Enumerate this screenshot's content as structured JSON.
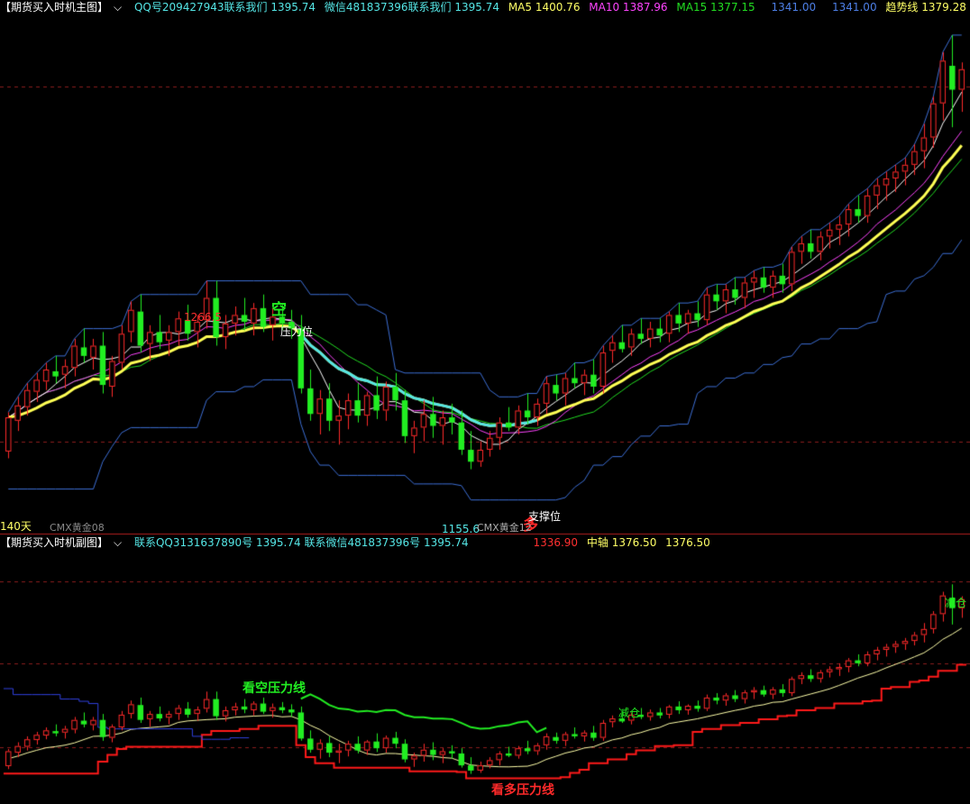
{
  "main_header": {
    "title": "【期货买入时机主图】",
    "qq": "QQ号209427943联系我们 1395.74",
    "wechat": "微信481837396联系我们 1395.74",
    "ma5": "MA5 1400.76",
    "ma10": "MA10 1387.96",
    "ma15": "MA15 1377.15",
    "band1": "1341.00",
    "band2": "1341.00",
    "trend": "趋势线 1379.28"
  },
  "sub_header": {
    "title": "【期货买入时机副图】",
    "contact": "联系QQ3131637890号 1395.74  联系微信481837396号 1395.74",
    "low_band": "1336.90",
    "mid_axis": "中轴 1376.50",
    "mid_axis_value": "1376.50"
  },
  "annotations": {
    "high_label": "1266.5",
    "low_label": "1155.6",
    "short_signal": "空",
    "long_signal": "多",
    "resistance": "压力位",
    "support": "支撑位",
    "days": "140天",
    "contract_left": "CMX黄金08",
    "contract_right": "CMX黄金12",
    "reduce1": "减仓",
    "reduce2": "减仓",
    "bear_line": "看空压力线",
    "bull_line": "看多压力线"
  },
  "colors": {
    "up": "#ff2a2a",
    "down": "#22ee22",
    "ma5": "#ffffff",
    "ma10": "#ff44ff",
    "ma15": "#22dd22",
    "trend": "#ffff55",
    "band": "#3d6fd6",
    "cyan": "#55e6e6",
    "grid": "#8a1d1d"
  },
  "chart_data": {
    "type": "candlestick",
    "candles": [
      [
        1166,
        1189,
        1162,
        1186
      ],
      [
        1184,
        1198,
        1178,
        1193
      ],
      [
        1192,
        1206,
        1187,
        1202
      ],
      [
        1201,
        1212,
        1195,
        1208
      ],
      [
        1207,
        1218,
        1202,
        1214
      ],
      [
        1213,
        1222,
        1206,
        1210
      ],
      [
        1211,
        1220,
        1203,
        1216
      ],
      [
        1215,
        1232,
        1210,
        1228
      ],
      [
        1227,
        1238,
        1218,
        1222
      ],
      [
        1221,
        1232,
        1214,
        1228
      ],
      [
        1228,
        1236,
        1200,
        1205
      ],
      [
        1204,
        1222,
        1198,
        1219
      ],
      [
        1218,
        1240,
        1214,
        1235
      ],
      [
        1236,
        1254,
        1230,
        1249
      ],
      [
        1248,
        1258,
        1224,
        1228
      ],
      [
        1229,
        1240,
        1219,
        1236
      ],
      [
        1236,
        1246,
        1226,
        1230
      ],
      [
        1231,
        1240,
        1222,
        1236
      ],
      [
        1236,
        1248,
        1228,
        1244
      ],
      [
        1243,
        1252,
        1231,
        1235
      ],
      [
        1236,
        1246,
        1227,
        1242
      ],
      [
        1243,
        1266,
        1238,
        1256
      ],
      [
        1256,
        1266,
        1228,
        1233
      ],
      [
        1233,
        1246,
        1226,
        1241
      ],
      [
        1241,
        1251,
        1234,
        1246
      ],
      [
        1246,
        1256,
        1237,
        1242
      ],
      [
        1241,
        1253,
        1234,
        1250
      ],
      [
        1250,
        1258,
        1236,
        1239
      ],
      [
        1240,
        1250,
        1231,
        1245
      ],
      [
        1245,
        1252,
        1237,
        1241
      ],
      [
        1242,
        1249,
        1232,
        1238
      ],
      [
        1238,
        1246,
        1200,
        1203
      ],
      [
        1203,
        1214,
        1184,
        1188
      ],
      [
        1188,
        1202,
        1176,
        1197
      ],
      [
        1197,
        1206,
        1178,
        1184
      ],
      [
        1184,
        1196,
        1170,
        1187
      ],
      [
        1187,
        1200,
        1179,
        1196
      ],
      [
        1196,
        1206,
        1183,
        1187
      ],
      [
        1187,
        1201,
        1181,
        1199
      ],
      [
        1199,
        1210,
        1185,
        1190
      ],
      [
        1190,
        1207,
        1184,
        1204
      ],
      [
        1204,
        1212,
        1190,
        1196
      ],
      [
        1196,
        1202,
        1171,
        1175
      ],
      [
        1175,
        1184,
        1165,
        1180
      ],
      [
        1180,
        1196,
        1172,
        1188
      ],
      [
        1188,
        1198,
        1174,
        1181
      ],
      [
        1181,
        1190,
        1170,
        1186
      ],
      [
        1186,
        1194,
        1176,
        1183
      ],
      [
        1183,
        1190,
        1164,
        1167
      ],
      [
        1167,
        1178,
        1155.6,
        1160
      ],
      [
        1160,
        1172,
        1157,
        1167
      ],
      [
        1167,
        1178,
        1163,
        1174
      ],
      [
        1174,
        1186,
        1167,
        1183
      ],
      [
        1183,
        1192,
        1178,
        1180
      ],
      [
        1180,
        1193,
        1176,
        1190
      ],
      [
        1190,
        1200,
        1182,
        1186
      ],
      [
        1186,
        1197,
        1181,
        1194
      ],
      [
        1194,
        1210,
        1188,
        1206
      ],
      [
        1205,
        1211,
        1196,
        1200
      ],
      [
        1200,
        1212,
        1193,
        1209
      ],
      [
        1209,
        1218,
        1203,
        1206
      ],
      [
        1206,
        1214,
        1199,
        1211
      ],
      [
        1211,
        1220,
        1200,
        1204
      ],
      [
        1204,
        1228,
        1200,
        1224
      ],
      [
        1225,
        1234,
        1218,
        1230
      ],
      [
        1230,
        1240,
        1224,
        1226
      ],
      [
        1227,
        1238,
        1222,
        1235
      ],
      [
        1235,
        1244,
        1229,
        1232
      ],
      [
        1232,
        1242,
        1227,
        1238
      ],
      [
        1238,
        1244,
        1230,
        1234
      ],
      [
        1235,
        1248,
        1230,
        1246
      ],
      [
        1246,
        1253,
        1236,
        1241
      ],
      [
        1241,
        1249,
        1235,
        1247
      ],
      [
        1247,
        1254,
        1239,
        1243
      ],
      [
        1243,
        1262,
        1240,
        1258
      ],
      [
        1258,
        1264,
        1249,
        1254
      ],
      [
        1254,
        1264,
        1247,
        1261
      ],
      [
        1261,
        1268,
        1252,
        1256
      ],
      [
        1256,
        1268,
        1250,
        1265
      ],
      [
        1265,
        1272,
        1256,
        1268
      ],
      [
        1268,
        1274,
        1259,
        1262
      ],
      [
        1262,
        1272,
        1256,
        1269
      ],
      [
        1269,
        1276,
        1259,
        1264
      ],
      [
        1264,
        1286,
        1260,
        1283
      ],
      [
        1283,
        1292,
        1276,
        1288
      ],
      [
        1288,
        1296,
        1279,
        1283
      ],
      [
        1283,
        1295,
        1278,
        1292
      ],
      [
        1292,
        1300,
        1285,
        1296
      ],
      [
        1296,
        1304,
        1287,
        1299
      ],
      [
        1299,
        1311,
        1292,
        1308
      ],
      [
        1308,
        1316,
        1300,
        1304
      ],
      [
        1304,
        1320,
        1300,
        1316
      ],
      [
        1316,
        1326,
        1308,
        1322
      ],
      [
        1322,
        1330,
        1313,
        1326
      ],
      [
        1326,
        1334,
        1318,
        1330
      ],
      [
        1330,
        1338,
        1322,
        1334
      ],
      [
        1334,
        1346,
        1328,
        1342
      ],
      [
        1342,
        1358,
        1332,
        1350
      ],
      [
        1350,
        1374,
        1344,
        1370
      ],
      [
        1370,
        1400,
        1360,
        1395
      ],
      [
        1392,
        1410,
        1356,
        1378
      ],
      [
        1378,
        1394,
        1365,
        1390
      ]
    ],
    "overlays": [
      "MA5",
      "MA10",
      "MA15",
      "趋势线"
    ],
    "y_axis": {
      "min": 1120,
      "max": 1420
    }
  }
}
